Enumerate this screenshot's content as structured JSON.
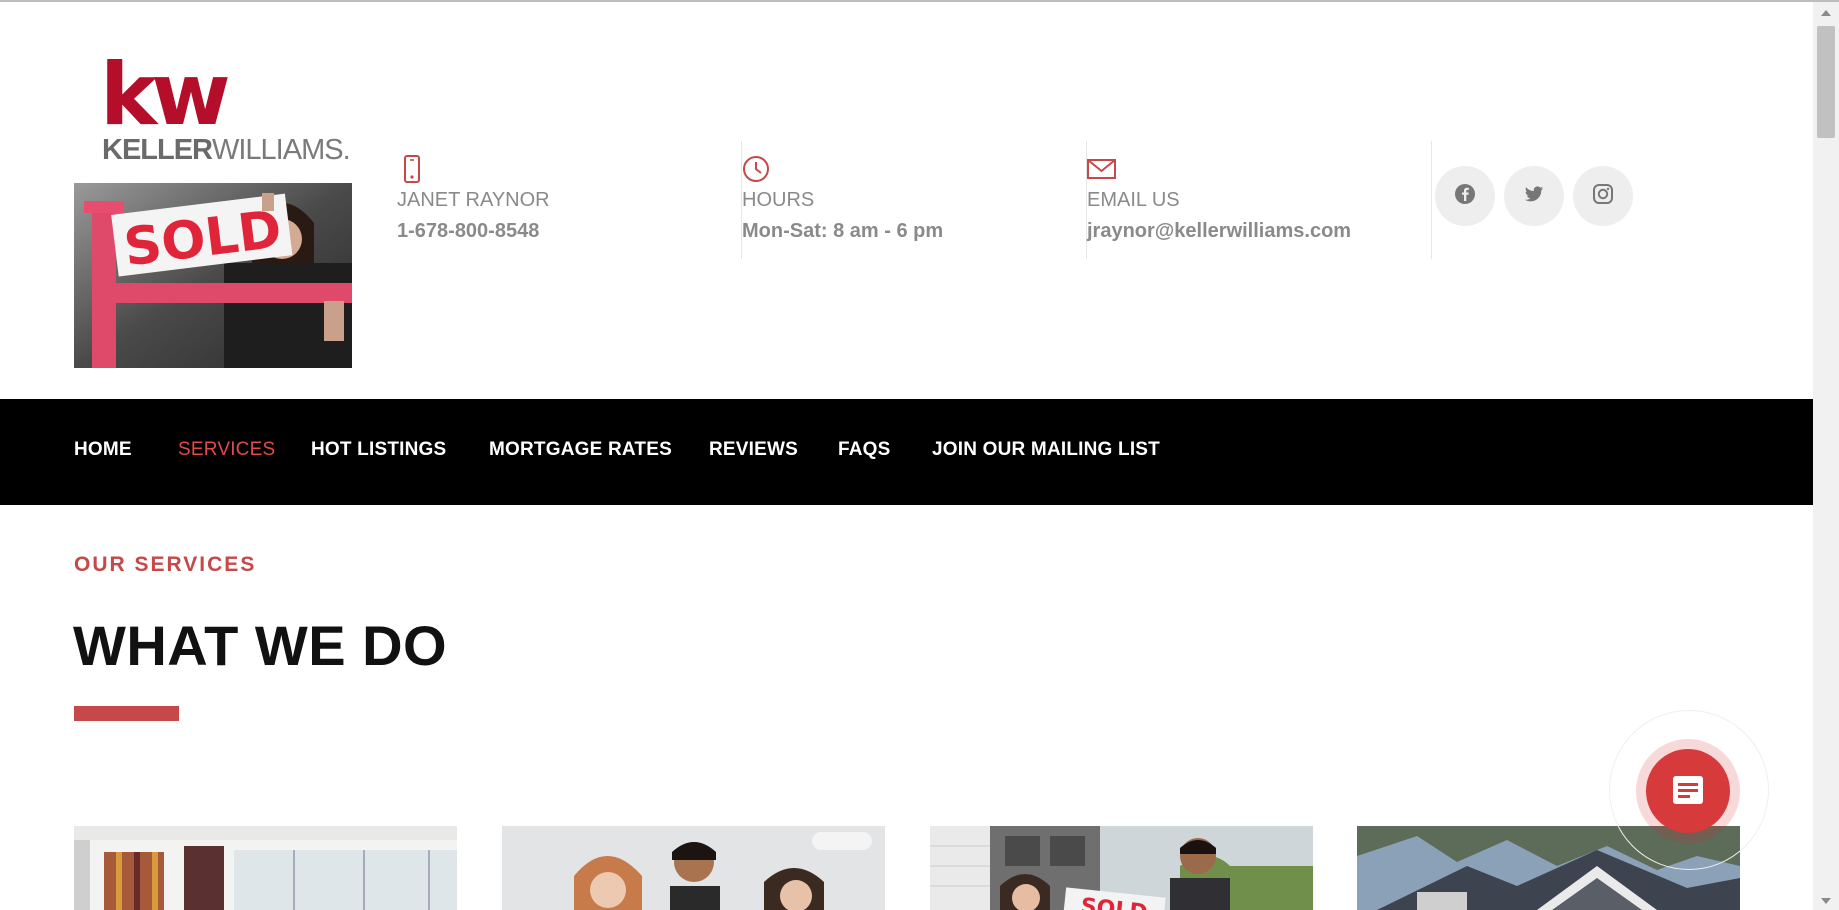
{
  "brand": {
    "logo_mark": "kw",
    "logo_name_bold": "KELLER",
    "logo_name_light": "WILLIAMS.",
    "brand_color": "#b40e2a"
  },
  "photo": {
    "sign_text": "SOLD"
  },
  "contact": [
    {
      "icon": "phone-icon",
      "label": "JANET RAYNOR",
      "value": "1-678-800-8548"
    },
    {
      "icon": "clock-icon",
      "label": "HOURS",
      "value": "Mon-Sat: 8 am - 6 pm"
    },
    {
      "icon": "mail-icon",
      "label": "EMAIL US",
      "value": "jraynor@kellerwilliams.com"
    }
  ],
  "social": [
    "facebook-icon",
    "twitter-icon",
    "instagram-icon"
  ],
  "nav": {
    "items": [
      {
        "label": "HOME",
        "active": false
      },
      {
        "label": "SERVICES",
        "active": true
      },
      {
        "label": "HOT LISTINGS",
        "active": false
      },
      {
        "label": "MORTGAGE RATES",
        "active": false
      },
      {
        "label": "REVIEWS",
        "active": false
      },
      {
        "label": "FAQS",
        "active": false
      },
      {
        "label": "JOIN OUR MAILING LIST",
        "active": false
      }
    ],
    "active_color": "#e04a4a"
  },
  "services": {
    "eyebrow": "OUR SERVICES",
    "title": "WHAT WE DO",
    "accent_color": "#c64848",
    "cards": [
      {
        "name": "interior-image"
      },
      {
        "name": "meeting-image"
      },
      {
        "name": "sold-couple-image",
        "sign_text": "SOLD"
      },
      {
        "name": "house-image"
      }
    ]
  },
  "chat": {
    "icon": "chat-icon",
    "color": "#d63a3a"
  }
}
